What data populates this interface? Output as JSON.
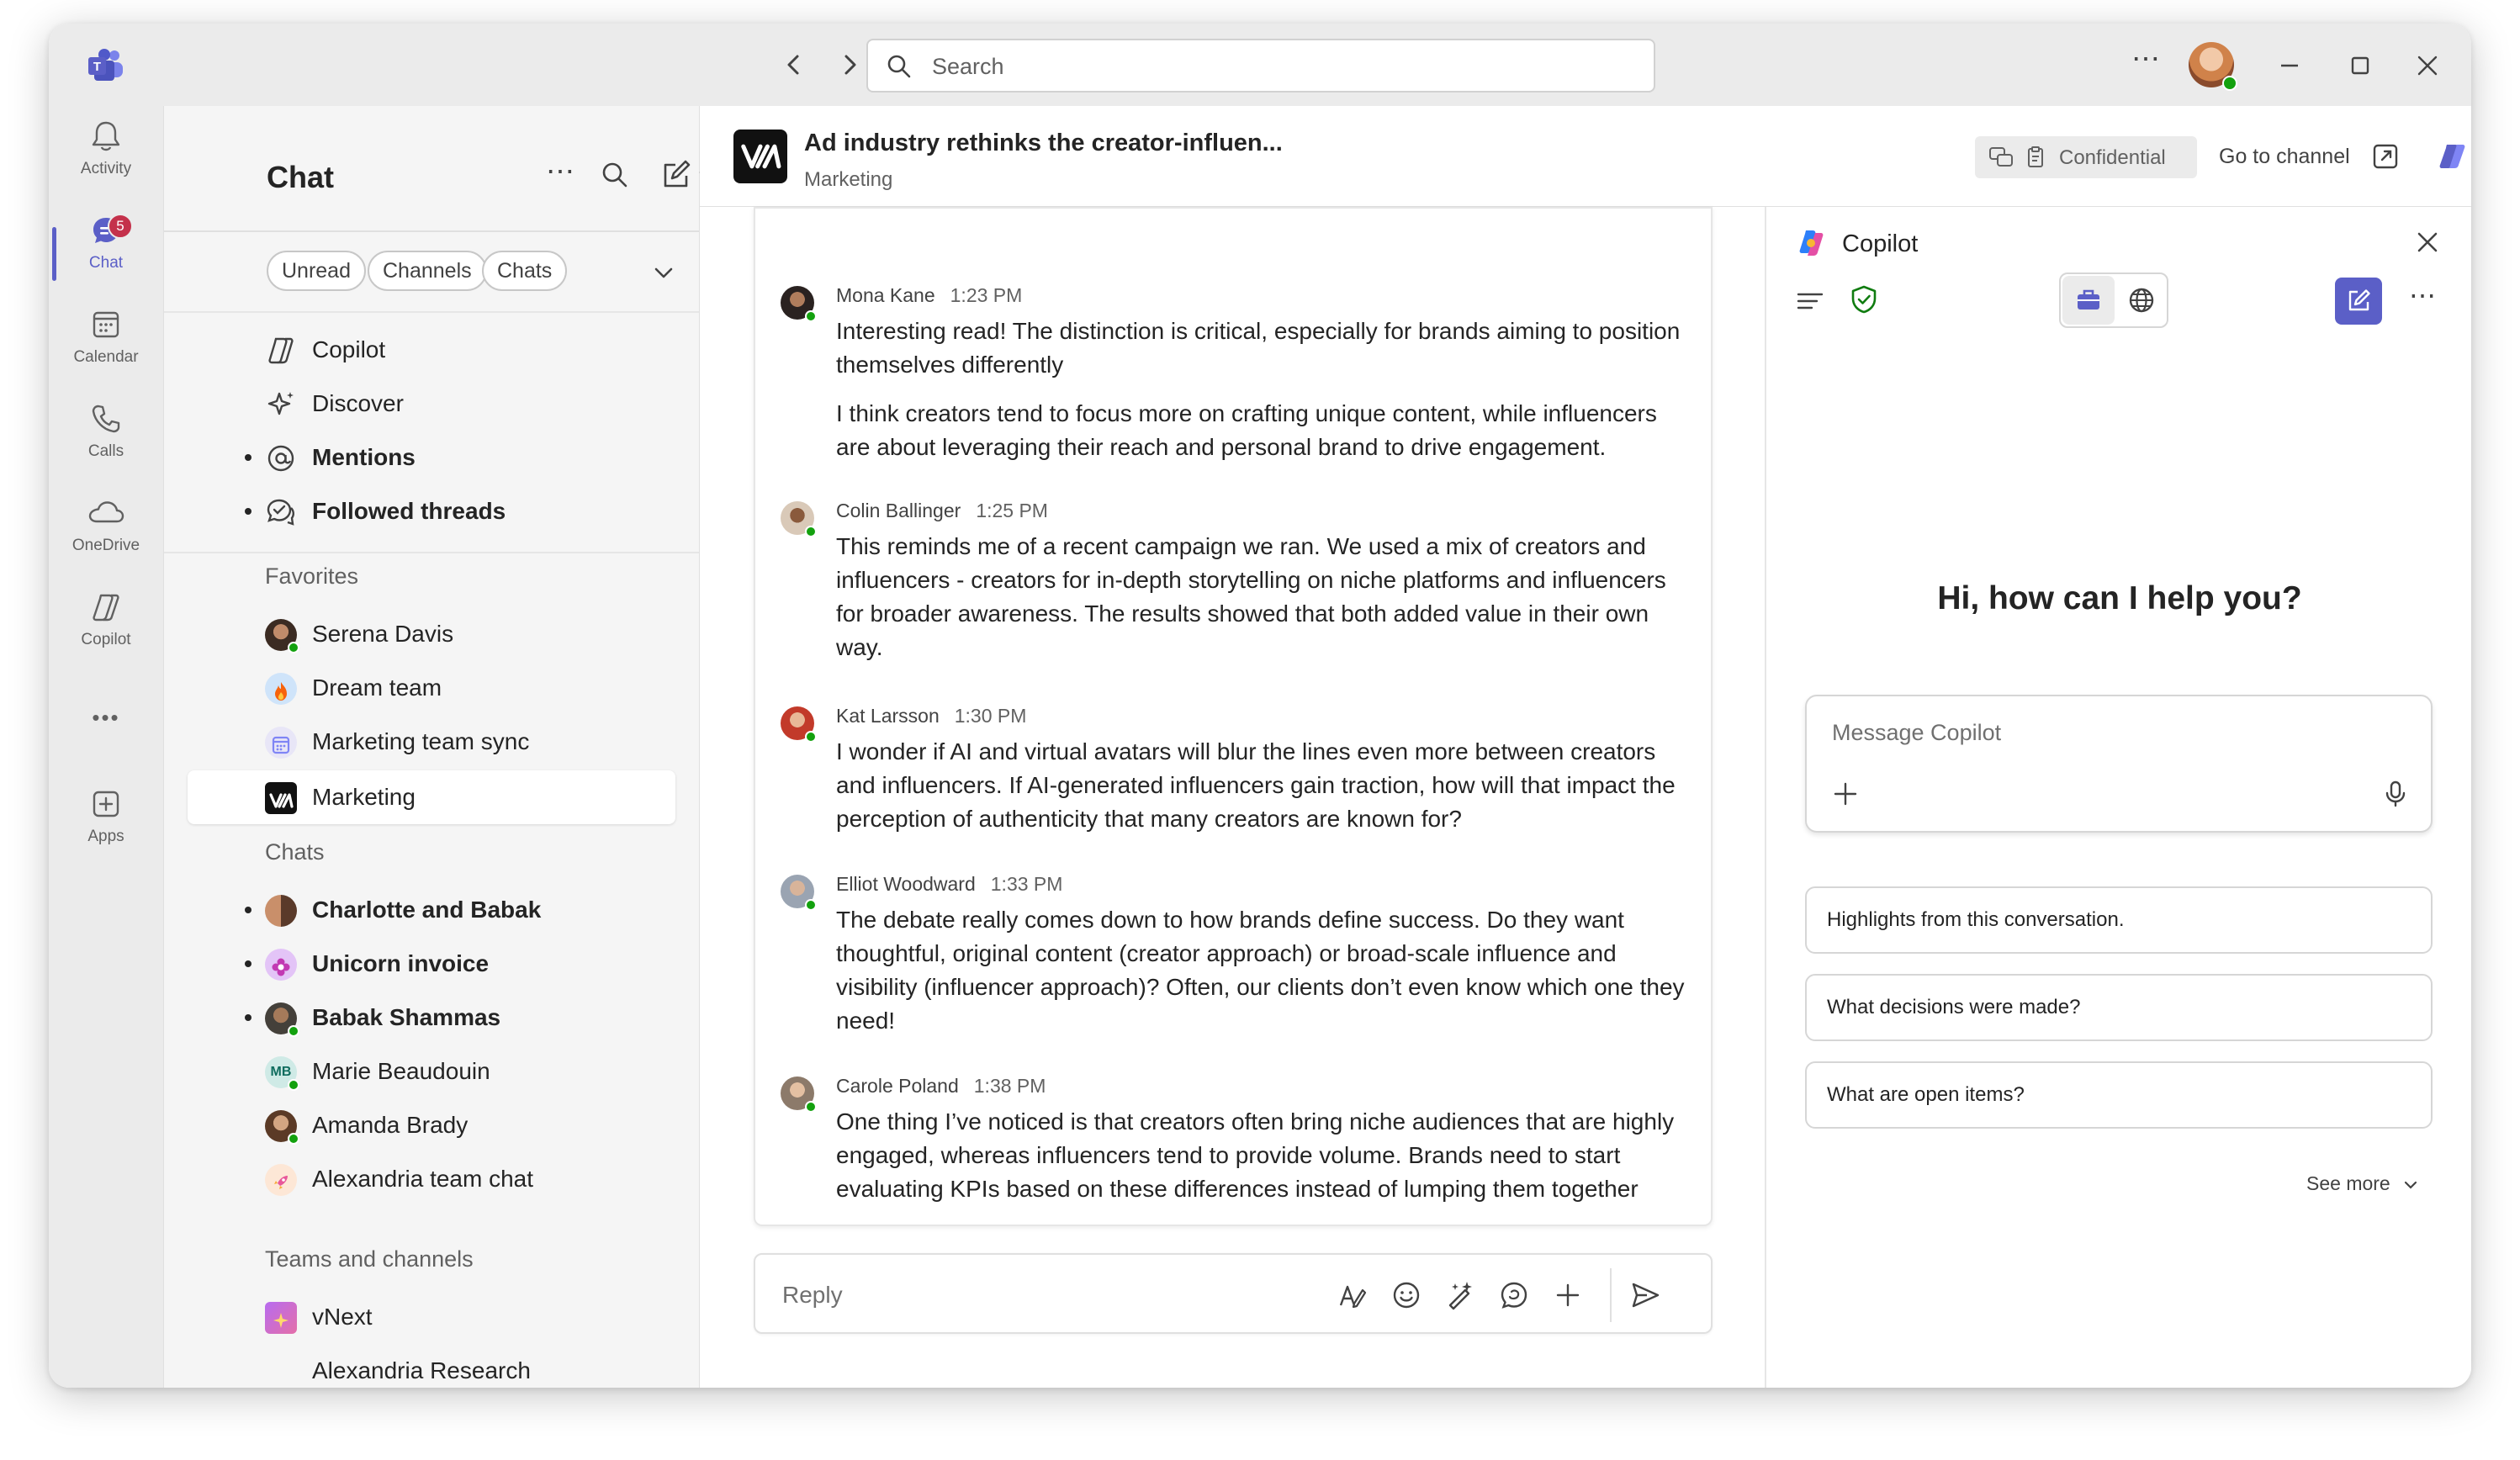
{
  "titlebar": {
    "search_placeholder": "Search",
    "more": "⋯"
  },
  "rail": {
    "items": [
      {
        "label": "Activity"
      },
      {
        "label": "Chat",
        "badge": "5"
      },
      {
        "label": "Calendar"
      },
      {
        "label": "Calls"
      },
      {
        "label": "OneDrive"
      },
      {
        "label": "Copilot"
      },
      {
        "label": "Apps"
      }
    ],
    "more": "•••"
  },
  "chatlist": {
    "title": "Chat",
    "filters": [
      "Unread",
      "Channels",
      "Chats"
    ],
    "top_items": [
      {
        "label": "Copilot"
      },
      {
        "label": "Discover"
      },
      {
        "label": "Mentions"
      },
      {
        "label": "Followed threads"
      }
    ],
    "favorites_header": "Favorites",
    "favorites": [
      {
        "label": "Serena Davis"
      },
      {
        "label": "Dream team"
      },
      {
        "label": "Marketing team sync"
      },
      {
        "label": "Marketing"
      }
    ],
    "chats_header": "Chats",
    "chats": [
      {
        "label": "Charlotte and Babak"
      },
      {
        "label": "Unicorn invoice"
      },
      {
        "label": "Babak Shammas"
      },
      {
        "label": "Marie Beaudouin",
        "initials": "MB"
      },
      {
        "label": "Amanda Brady"
      },
      {
        "label": "Alexandria team chat"
      }
    ],
    "teams_header": "Teams and channels",
    "teams": [
      {
        "label": "vNext"
      },
      {
        "label": "Alexandria Research"
      }
    ]
  },
  "thread": {
    "title": "Ad industry rethinks the creator-influen...",
    "subtitle": "Marketing",
    "confidential": "Confidential",
    "go_to_channel": "Go to channel",
    "messages": [
      {
        "name": "Mona Kane",
        "time": "1:23 PM",
        "paragraphs": [
          "Interesting read! The distinction is critical, especially for brands aiming to position themselves differently",
          "I think creators tend to focus more on crafting unique content, while influencers are about leveraging their reach and personal brand to drive engagement."
        ]
      },
      {
        "name": "Colin Ballinger",
        "time": "1:25 PM",
        "paragraphs": [
          "This reminds me of a recent campaign we ran. We used a mix of creators and influencers - creators for in-depth storytelling on niche platforms and influencers for broader awareness. The results showed that both added value in their own way."
        ]
      },
      {
        "name": "Kat Larsson",
        "time": "1:30 PM",
        "paragraphs": [
          "I wonder if AI and virtual avatars will blur the lines even more between creators and influencers. If AI-generated influencers gain traction, how will that impact the perception of authenticity that many creators are known for?"
        ]
      },
      {
        "name": "Elliot Woodward",
        "time": "1:33 PM",
        "paragraphs": [
          "The debate really comes down to how brands define success. Do they want thoughtful, original content (creator approach) or broad-scale influence and visibility (influencer approach)? Often, our clients don’t even know which one they need!"
        ]
      },
      {
        "name": "Carole Poland",
        "time": "1:38 PM",
        "paragraphs": [
          "One thing I’ve noticed is that creators often bring niche audiences that are highly engaged, whereas influencers tend to provide volume. Brands need to start evaluating KPIs based on these differences instead of lumping them together"
        ]
      }
    ],
    "reply_placeholder": "Reply"
  },
  "copilot": {
    "title": "Copilot",
    "greeting": "Hi, how can I help you?",
    "input_placeholder": "Message Copilot",
    "suggestions": [
      "Highlights from this conversation.",
      "What decisions were made?",
      "What are open items?"
    ],
    "see_more": "See more",
    "more": "⋯"
  },
  "colors": {
    "accent": "#5b5fc7",
    "presence": "#13a10e",
    "badge": "#c4314b"
  }
}
